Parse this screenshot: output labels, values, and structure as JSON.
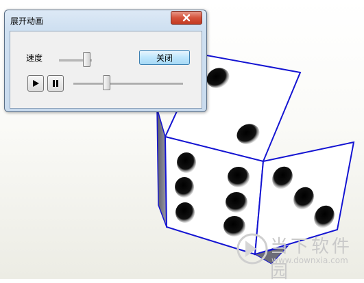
{
  "window": {
    "title": "展开动画",
    "close_icon": "close-x-icon"
  },
  "controls": {
    "speed_label": "速度",
    "close_button_label": "关闭",
    "speed_level": 0.8,
    "progress_level": 0.31,
    "play_icon": "play-icon",
    "pause_icon": "pause-icon"
  },
  "scene": {
    "object": "die",
    "edge_color": "#1414d2",
    "pip_color": "#000000",
    "face_color": "#ffffff"
  },
  "watermark": {
    "name": "当下软件园",
    "url": "www.downxia.com"
  }
}
